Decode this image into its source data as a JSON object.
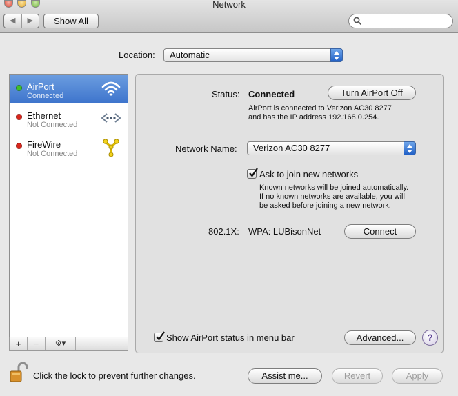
{
  "window": {
    "title": "Network"
  },
  "toolbar": {
    "back_glyph": "◀",
    "forward_glyph": "▶",
    "show_all_label": "Show All",
    "search_placeholder": ""
  },
  "location": {
    "label": "Location:",
    "value": "Automatic"
  },
  "services": [
    {
      "name": "AirPort",
      "status": "Connected",
      "status_color": "#3fbf2a",
      "icon": "wifi-icon",
      "selected": true
    },
    {
      "name": "Ethernet",
      "status": "Not Connected",
      "status_color": "#d9261c",
      "icon": "ethernet-icon",
      "selected": false
    },
    {
      "name": "FireWire",
      "status": "Not Connected",
      "status_color": "#d9261c",
      "icon": "firewire-icon",
      "selected": false
    }
  ],
  "list_toolbar": {
    "add_label": "+",
    "remove_label": "−",
    "action_label": "⚙▾"
  },
  "detail": {
    "status_label": "Status:",
    "status_value": "Connected",
    "turn_off_label": "Turn AirPort Off",
    "status_desc_line1": "AirPort is connected to Verizon AC30 8277",
    "status_desc_line2": "and has the IP address 192.168.0.254.",
    "network_name_label": "Network Name:",
    "network_name_value": "Verizon AC30 8277",
    "ask_join_label": "Ask to join new networks",
    "ask_join_checked": true,
    "ask_join_desc_line1": "Known networks will be joined automatically.",
    "ask_join_desc_line2": "If no known networks are available, you will",
    "ask_join_desc_line3": "be asked before joining a new network.",
    "dot1x_label": "802.1X:",
    "dot1x_value": "WPA: LUBisonNet",
    "connect_label": "Connect",
    "show_status_label": "Show AirPort status in menu bar",
    "show_status_checked": true,
    "advanced_label": "Advanced...",
    "help_label": "?"
  },
  "footer": {
    "lock_label": "Click the lock to prevent further changes.",
    "assist_label": "Assist me...",
    "revert_label": "Revert",
    "apply_label": "Apply"
  },
  "colors": {
    "selection": "#3d74cc",
    "popup_arrow": "#2160c6"
  }
}
